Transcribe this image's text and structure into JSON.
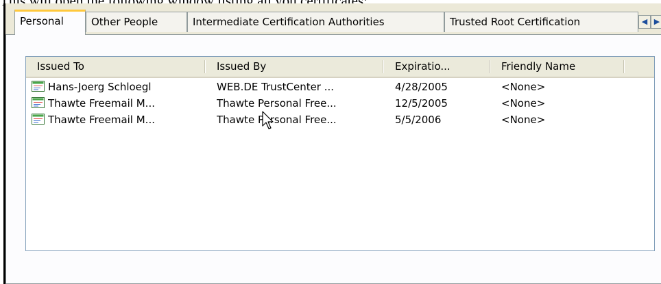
{
  "caption": "This will open the following window listing all you certificates:",
  "tabs": [
    {
      "label": "Personal"
    },
    {
      "label": "Other People"
    },
    {
      "label": "Intermediate Certification Authorities"
    },
    {
      "label": "Trusted Root Certification"
    }
  ],
  "tab_scroll": {
    "left": "◀",
    "right": "▶"
  },
  "columns": [
    "Issued To",
    "Issued By",
    "Expiratio...",
    "Friendly Name"
  ],
  "rows": [
    {
      "issued_to": "Hans-Joerg Schloegl",
      "issued_by": "WEB.DE TrustCenter ...",
      "expiration": "4/28/2005",
      "friendly_name": "<None>"
    },
    {
      "issued_to": "Thawte Freemail M...",
      "issued_by": "Thawte Personal Free...",
      "expiration": "12/5/2005",
      "friendly_name": "<None>"
    },
    {
      "issued_to": "Thawte Freemail M...",
      "issued_by": "Thawte Personal Free...",
      "expiration": "5/5/2006",
      "friendly_name": "<None>"
    }
  ],
  "colors": {
    "active_tab_accent": "#ffc83c",
    "dialog_bg": "#ece9d8",
    "list_border": "#7f9db9"
  }
}
